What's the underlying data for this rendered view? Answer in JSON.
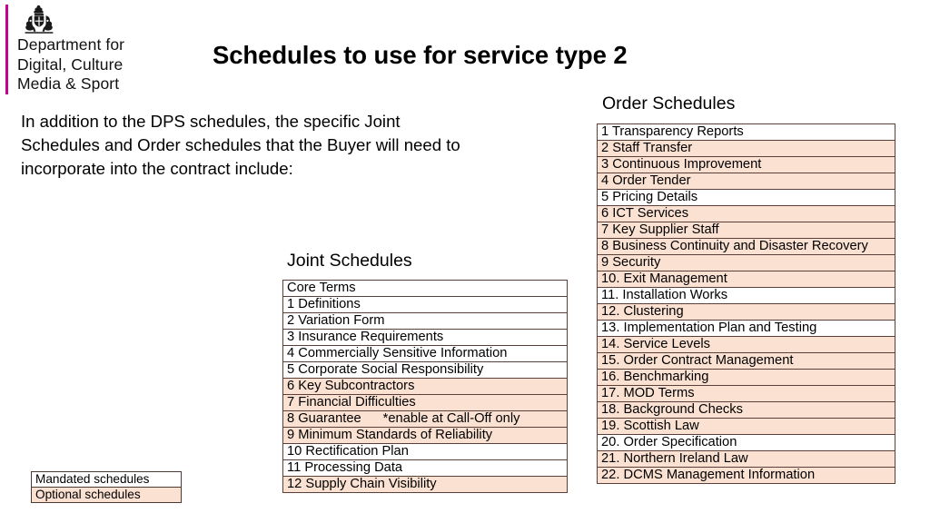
{
  "logo": {
    "crest_icon": "royal-crest-icon",
    "bar_color": "#c8008f",
    "line1": "Department for",
    "line2": "Digital, Culture",
    "line3": "Media & Sport"
  },
  "title": "Schedules to use for service type 2",
  "intro": "In addition to the DPS schedules, the specific Joint Schedules and Order schedules that the Buyer will need to incorporate into the contract include:",
  "joint": {
    "heading": "Joint Schedules",
    "rows": [
      {
        "label": "Core Terms",
        "status": "mandated"
      },
      {
        "label": "1 Definitions",
        "status": "mandated"
      },
      {
        "label": "2 Variation Form",
        "status": "mandated"
      },
      {
        "label": "3 Insurance Requirements",
        "status": "mandated"
      },
      {
        "label": "4 Commercially Sensitive Information",
        "status": "mandated"
      },
      {
        "label": "5 Corporate Social Responsibility",
        "status": "mandated"
      },
      {
        "label": "6 Key Subcontractors",
        "status": "optional"
      },
      {
        "label": "7 Financial Difficulties",
        "status": "optional"
      },
      {
        "label": "8 Guarantee",
        "note": "*enable at Call-Off only",
        "status": "optional"
      },
      {
        "label": "9 Minimum Standards of Reliability",
        "status": "optional"
      },
      {
        "label": "10 Rectification Plan",
        "status": "mandated"
      },
      {
        "label": "11 Processing Data",
        "status": "mandated"
      },
      {
        "label": "12 Supply Chain Visibility",
        "status": "optional"
      }
    ]
  },
  "order": {
    "heading": "Order Schedules",
    "rows": [
      {
        "label": "1 Transparency Reports",
        "status": "mandated"
      },
      {
        "label": "2 Staff Transfer",
        "status": "optional"
      },
      {
        "label": "3 Continuous Improvement",
        "status": "optional"
      },
      {
        "label": "4 Order Tender",
        "status": "optional"
      },
      {
        "label": "5 Pricing Details",
        "status": "mandated"
      },
      {
        "label": "6 ICT Services",
        "status": "optional"
      },
      {
        "label": "7 Key Supplier Staff",
        "status": "optional"
      },
      {
        "label": "8 Business Continuity and Disaster Recovery",
        "status": "optional"
      },
      {
        "label": "9 Security",
        "status": "optional"
      },
      {
        "label": "10. Exit Management",
        "status": "optional"
      },
      {
        "label": "11. Installation Works",
        "status": "mandated"
      },
      {
        "label": "12. Clustering",
        "status": "optional"
      },
      {
        "label": "13. Implementation Plan and Testing",
        "status": "mandated"
      },
      {
        "label": "14. Service Levels",
        "status": "optional"
      },
      {
        "label": "15. Order Contract Management",
        "status": "optional"
      },
      {
        "label": "16. Benchmarking",
        "status": "optional"
      },
      {
        "label": "17. MOD Terms",
        "status": "optional"
      },
      {
        "label": "18. Background Checks",
        "status": "optional"
      },
      {
        "label": "19. Scottish Law",
        "status": "optional"
      },
      {
        "label": "20. Order Specification",
        "status": "mandated"
      },
      {
        "label": "21. Northern Ireland Law",
        "status": "optional"
      },
      {
        "label": "22. DCMS Management Information",
        "status": "optional"
      }
    ]
  },
  "legend": {
    "rows": [
      {
        "label": "Mandated schedules",
        "status": "mandated"
      },
      {
        "label": "Optional schedules",
        "status": "optional"
      }
    ]
  },
  "colors": {
    "optional_fill": "#fae1d2",
    "mandated_fill": "#ffffff",
    "table_border": "#5a4038",
    "brand_pink": "#c8008f"
  }
}
